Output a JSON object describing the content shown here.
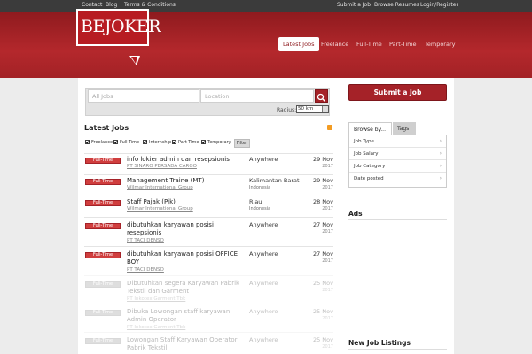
{
  "topbar": {
    "left_links": [
      "Contact",
      "Blog",
      "Terms & Conditions"
    ],
    "right_links": [
      "Submit a Job",
      "Browse Resumes",
      "Login/Register"
    ]
  },
  "header": {
    "logo_text": "BEJOKER",
    "nav": [
      "Latest Jobs",
      "Freelance",
      "Full-Time",
      "Part-Time",
      "Temporary"
    ],
    "active_nav": "Latest Jobs"
  },
  "search": {
    "keyword_placeholder": "All Jobs",
    "location_placeholder": "Location",
    "radius_label": "Radius:",
    "radius_value": "50 km",
    "search_icon": "search-icon"
  },
  "latest": {
    "title": "Latest Jobs",
    "filters": [
      "Freelance",
      "Full-Time",
      "Internship",
      "Part-Time",
      "Temporary"
    ],
    "filter_button": "Filter",
    "jobs": [
      {
        "type": "Full-Time",
        "title": "info lokier admin dan resepsionis",
        "company": "PT SINARO PERSADA CARGO",
        "location": "Anywhere",
        "location_sub": "",
        "date": "29 Nov",
        "year": "2017"
      },
      {
        "type": "Full-Time",
        "title": "Management Traine (MT)",
        "company": "Wilmar International Group",
        "location": "Kalimantan Barat",
        "location_sub": "Indonesia",
        "date": "29 Nov",
        "year": "2017"
      },
      {
        "type": "Full-Time",
        "title": "Staff Pajak (Pjk)",
        "company": "Wilmar International Group",
        "location": "Riau",
        "location_sub": "Indonesia",
        "date": "28 Nov",
        "year": "2017"
      },
      {
        "type": "Full-Time",
        "title": "dibutuhkan karyawan posisi resepsionis",
        "company": "PT TACI DENSO",
        "location": "Anywhere",
        "location_sub": "",
        "date": "27 Nov",
        "year": "2017"
      },
      {
        "type": "Full-Time",
        "title": "dibutuhkan karyawan posisi OFFICE BOY",
        "company": "PT TACI DENSO",
        "location": "Anywhere",
        "location_sub": "",
        "date": "27 Nov",
        "year": "2017"
      },
      {
        "type": "Full-Time",
        "title": "Dibutuhkan segera Karyawan Pabrik Tekstil dan Garment",
        "company": "PT Inkotex Garment Tbk",
        "location": "Anywhere",
        "location_sub": "",
        "date": "25 Nov",
        "year": "2017"
      },
      {
        "type": "Full-Time",
        "title": "Dibuka Lowongan staff karyawan Admin Operator",
        "company": "PT Inkotex Garment Tbk",
        "location": "Anywhere",
        "location_sub": "",
        "date": "25 Nov",
        "year": "2017"
      },
      {
        "type": "Full-Time",
        "title": "Lowongan Staff Karyawan Operator Pabrik Tekstil",
        "company": "",
        "location": "Anywhere",
        "location_sub": "",
        "date": "25 Nov",
        "year": "2017"
      }
    ]
  },
  "sidebar": {
    "submit_label": "Submit a Job",
    "tabs": [
      "Browse by...",
      "Tags"
    ],
    "browse_items": [
      "Job Type",
      "Job Salary",
      "Job Category",
      "Date posted"
    ],
    "ads_title": "Ads",
    "new_listings_title": "New Job Listings"
  },
  "colors": {
    "brand": "#a52228",
    "header": "#b4282c",
    "topbar": "#3b3b3b"
  }
}
